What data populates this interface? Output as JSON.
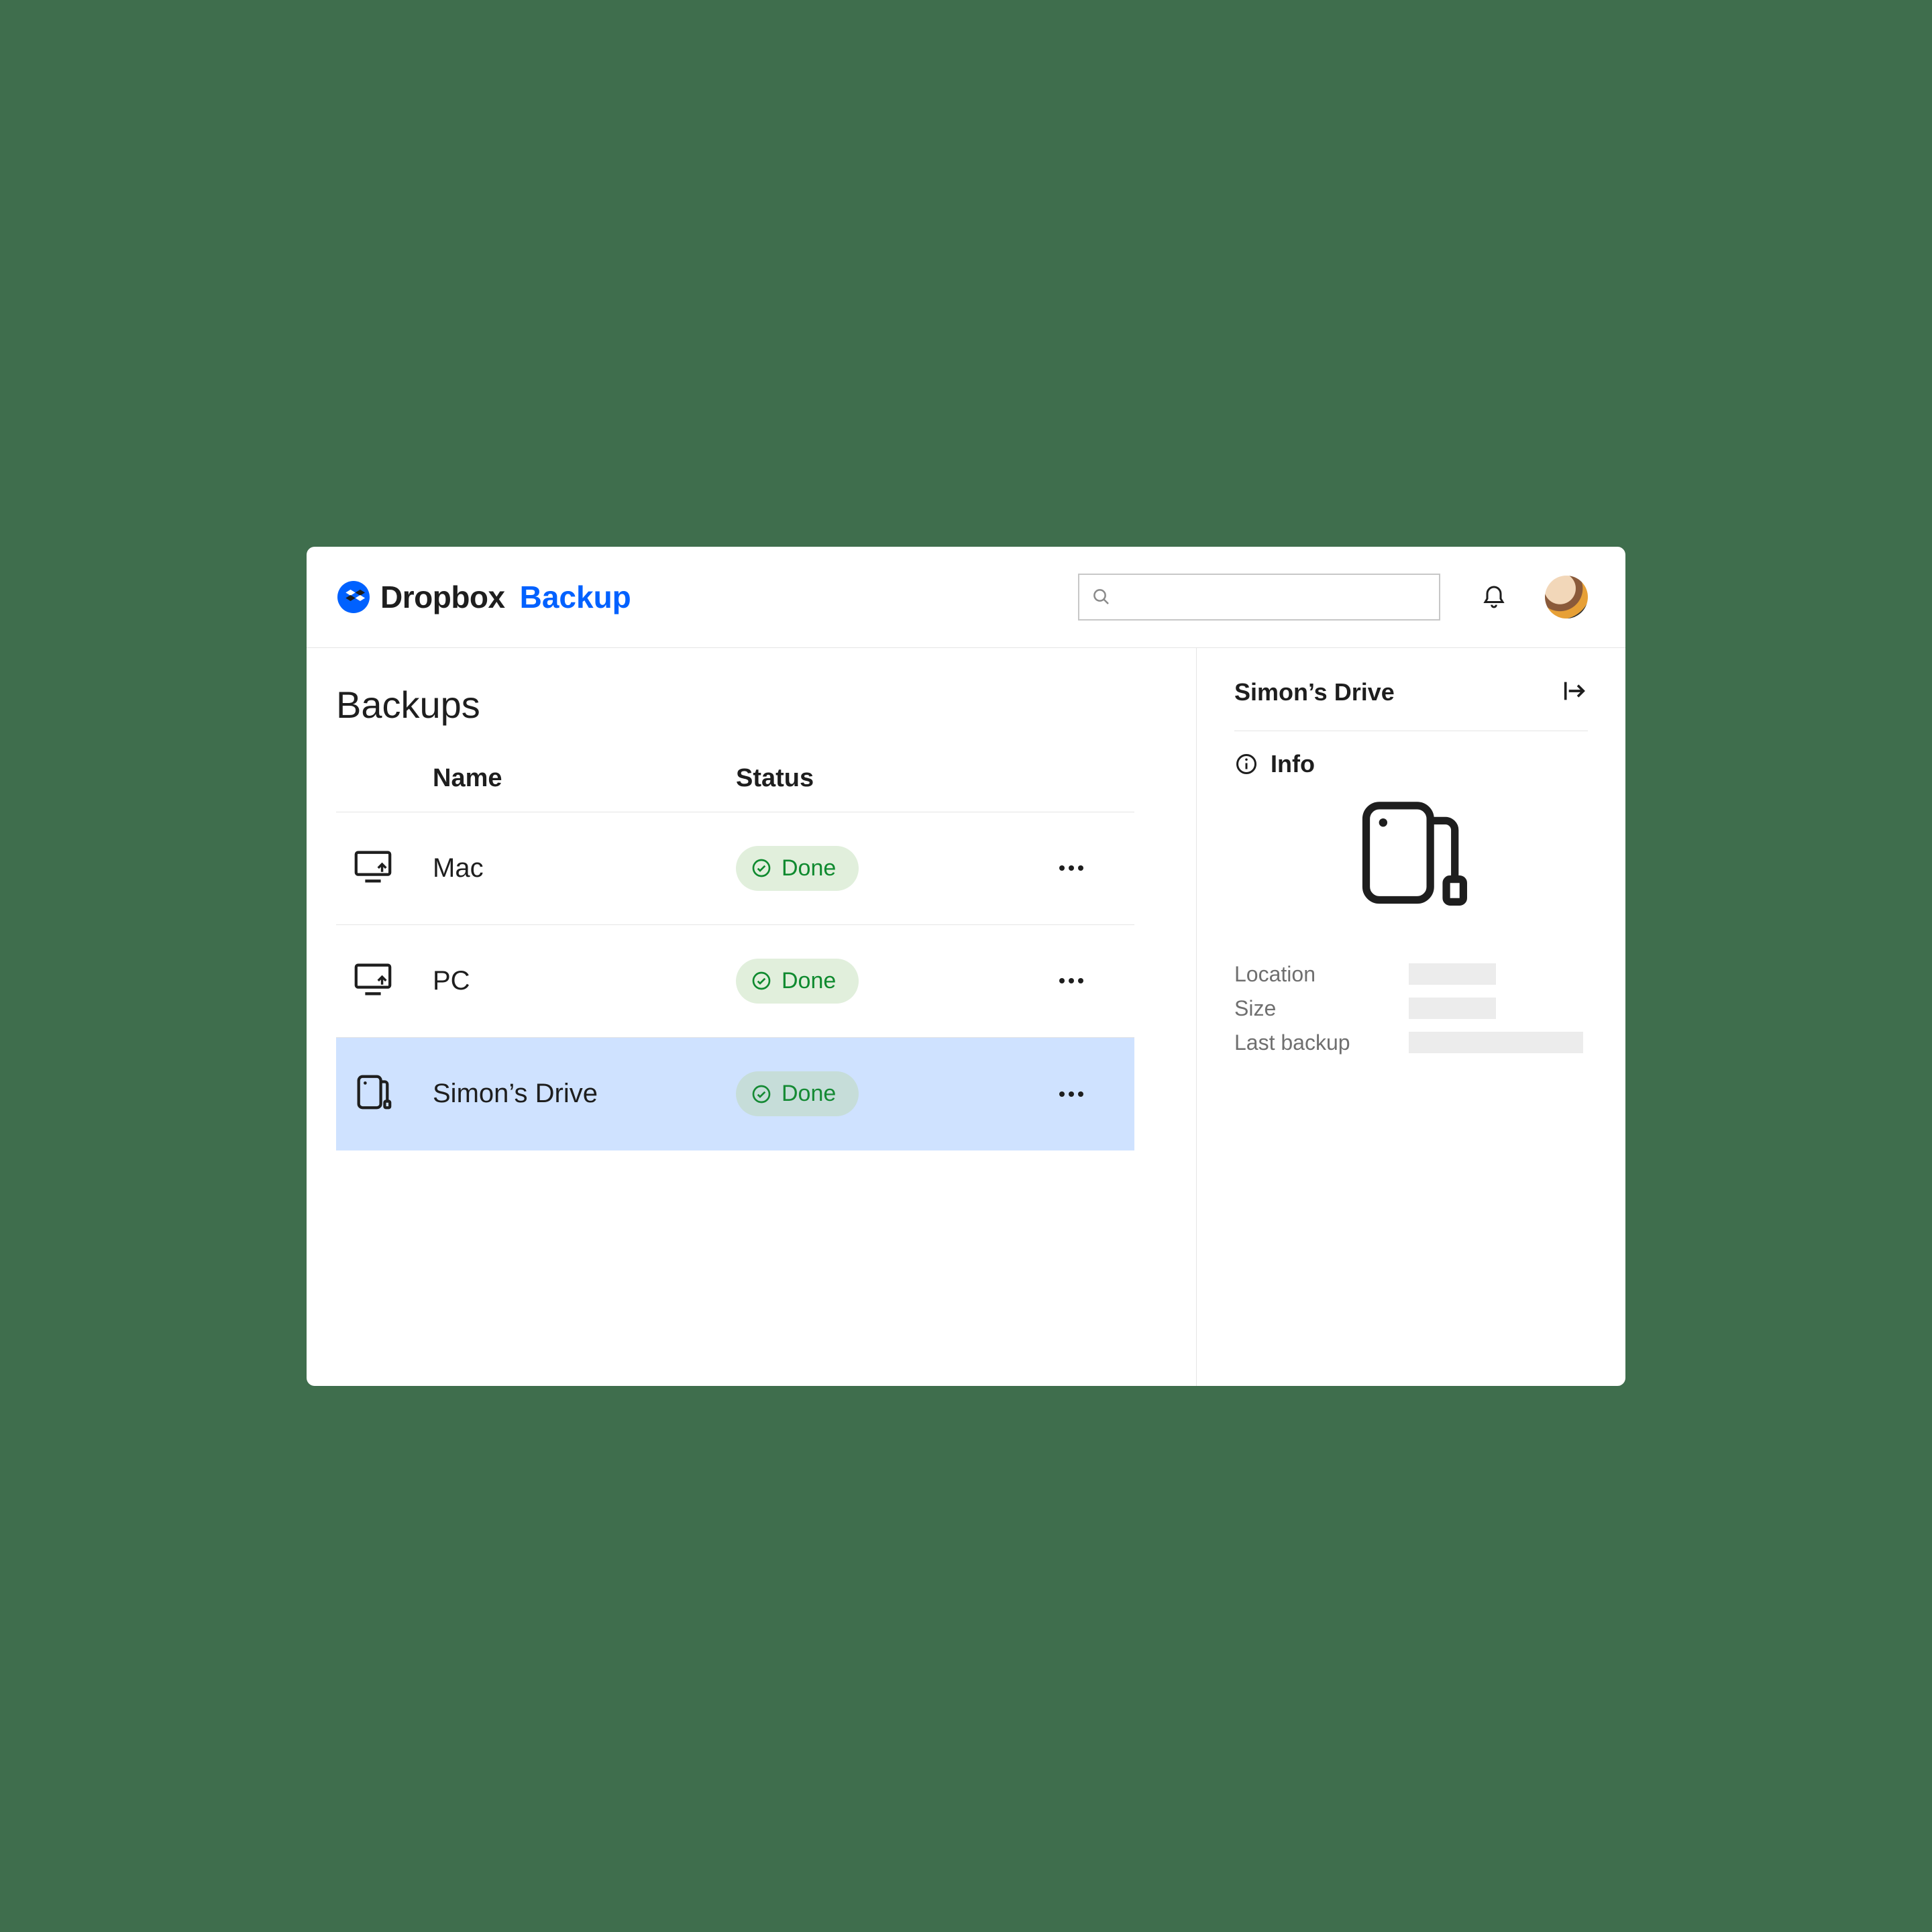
{
  "brand": {
    "name": "Dropbox",
    "sub": "Backup"
  },
  "page": {
    "title": "Backups"
  },
  "table": {
    "headers": {
      "name": "Name",
      "status": "Status"
    },
    "rows": [
      {
        "icon": "monitor-icon",
        "name": "Mac",
        "status": "Done",
        "selected": false
      },
      {
        "icon": "monitor-icon",
        "name": "PC",
        "status": "Done",
        "selected": false
      },
      {
        "icon": "external-drive-icon",
        "name": "Simon’s Drive",
        "status": "Done",
        "selected": true
      }
    ]
  },
  "side": {
    "title": "Simon’s Drive",
    "info_label": "Info",
    "meta": {
      "location_label": "Location",
      "size_label": "Size",
      "last_backup_label": "Last backup"
    }
  },
  "colors": {
    "brand_blue": "#0061ff",
    "status_green": "#0f8a2f",
    "selection_bg": "#cfe2ff",
    "page_bg": "#3f6e4d"
  }
}
